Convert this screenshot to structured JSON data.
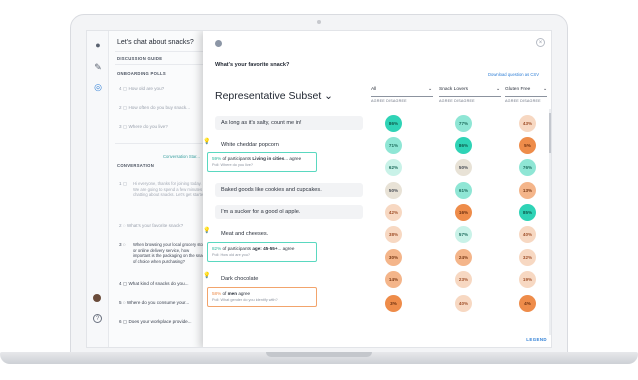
{
  "sidebar": {
    "title": "Let's chat about snacks?",
    "sections": [
      {
        "label": "DISCUSSION GUIDE",
        "top": 0
      },
      {
        "label": "ONBOARDING POLLS"
      },
      {
        "label": "CONVERSATION"
      }
    ],
    "items": [
      {
        "num": "4",
        "text": "How old are you?"
      },
      {
        "num": "2",
        "text": "How often do you buy snack..."
      },
      {
        "num": "3",
        "text": "Where do you live?"
      }
    ],
    "conversation_tag": "Conversation Star...",
    "intro_text": "Hi everyone, thanks for joining today. We are going to spend a few minutes chatting about snacks. Let's get started.",
    "conv_items": [
      {
        "num": "2",
        "text": "What's your favorite snack?"
      },
      {
        "num": "3",
        "text": "When browsing your local grocery store or online delivery service, how important is the packaging on the snack of choice when purchasing?"
      },
      {
        "num": "4",
        "text": "What kind of snacks do you..."
      },
      {
        "num": "5",
        "text": "Where do you consume your..."
      },
      {
        "num": "6",
        "text": "Does your workplace provide..."
      }
    ],
    "help_glyph": "?"
  },
  "panel": {
    "question": "What's your favorite snack?",
    "download": "Download question as CSV",
    "subset_title": "Representative Subset",
    "close_glyph": "×",
    "legend": "LEGEND",
    "segments": [
      {
        "name": "All",
        "sort": "AGREE  DISAGREE"
      },
      {
        "name": "Snack Lovers",
        "sort": "AGREE  DISAGREE"
      },
      {
        "name": "Gluten Free",
        "sort": "AGREE  DISAGREE"
      }
    ],
    "rows": [
      {
        "text": "As long as it's salty, count me in!",
        "values": [
          "86%",
          "77%",
          "43%"
        ]
      },
      {
        "text": "White cheddar popcorn",
        "values": [
          "71%",
          "86%",
          "5%"
        ]
      },
      {
        "text": "",
        "values": [
          "62%",
          "50%",
          "76%"
        ]
      },
      {
        "text": "Baked goods like cookies and cupcakes.",
        "values": [
          "50%",
          "61%",
          "13%"
        ]
      },
      {
        "text": "I'm a sucker for a good ol apple.",
        "values": [
          "42%",
          "16%",
          "85%"
        ]
      },
      {
        "text": "Meat and cheeses.",
        "values": [
          "38%",
          "57%",
          "40%"
        ]
      },
      {
        "text": "",
        "values": [
          "30%",
          "24%",
          "32%"
        ]
      },
      {
        "text": "Dark chocolate",
        "values": [
          "14%",
          "23%",
          "19%"
        ]
      },
      {
        "text": "",
        "values": [
          "3%",
          "40%",
          "4%"
        ]
      }
    ],
    "insights": [
      {
        "pct": "59%",
        "mid": " of participants ",
        "hl": "Living in cities",
        "tail": "... agree",
        "q": "Poll: Where do you live?"
      },
      {
        "pct": "82%",
        "mid": " of participants ",
        "hl": "age: 45-55+",
        "tail": "... agree",
        "q": "Poll: How old are you?"
      },
      {
        "pct": "58%",
        "mid": " of ",
        "hl": "men",
        "tail": " agree",
        "q": "Poll: What gender do you identify with?"
      }
    ]
  },
  "colors": {
    "teal_strong": "#2fd3b6",
    "teal_mid": "#8fe6d5",
    "teal_light": "#c9f2e8",
    "neutral": "#e8e2d6",
    "peach_light": "#f7d8c2",
    "orange_mid": "#f4b58a",
    "orange_strong": "#ee8c4a",
    "accent_blue": "#2f7fd6"
  }
}
